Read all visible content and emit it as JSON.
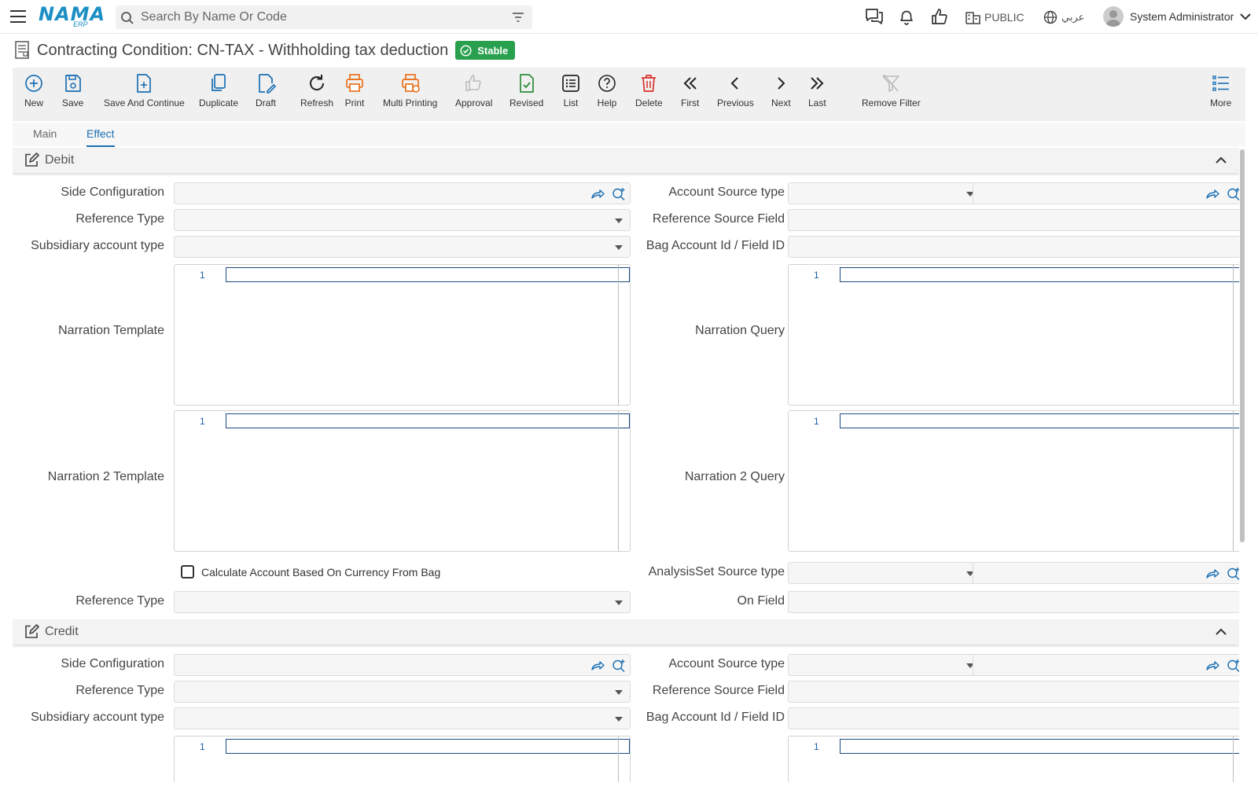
{
  "topbar": {
    "logo_text": "NAMA",
    "logo_sub": "ERP",
    "search_placeholder": "Search By Name Or Code",
    "public_label": "PUBLIC",
    "language_label": "عربي",
    "user_name": "System Administrator"
  },
  "page": {
    "title": "Contracting Condition: CN-TAX - Withholding tax deduction",
    "status_badge": "Stable"
  },
  "toolbar": {
    "items": [
      {
        "label": "New",
        "icon": "plus-circle-icon"
      },
      {
        "label": "Save",
        "icon": "save-icon"
      },
      {
        "label": "Save And Continue",
        "icon": "file-plus-icon"
      },
      {
        "label": "Duplicate",
        "icon": "copy-icon"
      },
      {
        "label": "Draft",
        "icon": "draft-edit-icon"
      },
      {
        "label": "Refresh",
        "icon": "refresh-icon"
      },
      {
        "label": "Print",
        "icon": "printer-icon"
      },
      {
        "label": "Multi Printing",
        "icon": "multi-printer-icon"
      },
      {
        "label": "Approval",
        "icon": "thumbs-up-icon"
      },
      {
        "label": "Revised",
        "icon": "file-check-icon"
      },
      {
        "label": "List",
        "icon": "list-icon"
      },
      {
        "label": "Help",
        "icon": "help-icon"
      },
      {
        "label": "Delete",
        "icon": "trash-icon"
      },
      {
        "label": "First",
        "icon": "double-chevron-left-icon"
      },
      {
        "label": "Previous",
        "icon": "chevron-left-icon"
      },
      {
        "label": "Next",
        "icon": "chevron-right-icon"
      },
      {
        "label": "Last",
        "icon": "double-chevron-right-icon"
      },
      {
        "label": "Remove Filter",
        "icon": "filter-off-icon"
      },
      {
        "label": "More",
        "icon": "more-list-icon"
      }
    ]
  },
  "tabs": [
    {
      "label": "Main",
      "active": false
    },
    {
      "label": "Effect",
      "active": true
    }
  ],
  "debit": {
    "title": "Debit",
    "side_configuration": "Side Configuration",
    "reference_type": "Reference Type",
    "subsidiary_account_type": "Subsidiary account type",
    "narration_template": "Narration Template",
    "narration_2_template": "Narration 2 Template",
    "account_source_type": "Account Source type",
    "reference_source_field": "Reference Source Field",
    "bag_account_id": "Bag Account Id / Field ID",
    "narration_query": "Narration Query",
    "narration_2_query": "Narration 2 Query",
    "calc_checkbox": "Calculate Account Based On Currency From Bag",
    "calc_checked": false,
    "reference_type_2": "Reference Type",
    "analysisset_source_type": "AnalysisSet Source type",
    "on_field": "On Field",
    "line_number": "1"
  },
  "credit": {
    "title": "Credit",
    "side_configuration": "Side Configuration",
    "reference_type": "Reference Type",
    "subsidiary_account_type": "Subsidiary account type",
    "account_source_type": "Account Source type",
    "reference_source_field": "Reference Source Field",
    "bag_account_id": "Bag Account Id / Field ID",
    "line_number": "1"
  },
  "colors": {
    "accent_blue": "#1a6fb3",
    "stable_green": "#28a04d",
    "print_orange": "#e8711c",
    "delete_red": "#d9312b",
    "revised_green": "#2e8b3a"
  }
}
